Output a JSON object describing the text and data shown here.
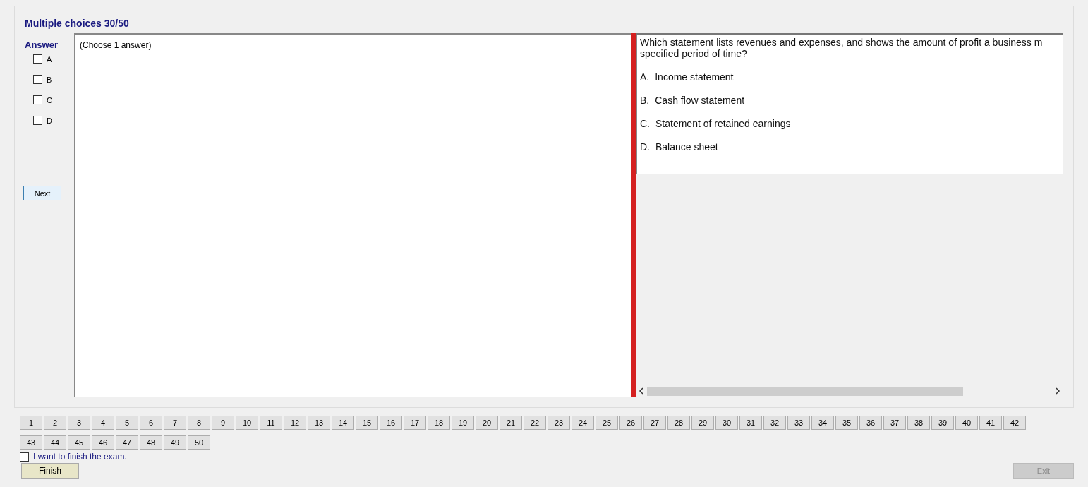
{
  "title": "Multiple choices 30/50",
  "answer_panel": {
    "heading": "Answer",
    "options": [
      {
        "label": "A",
        "checked": false
      },
      {
        "label": "B",
        "checked": false
      },
      {
        "label": "C",
        "checked": false
      },
      {
        "label": "D",
        "checked": false
      }
    ],
    "next_button": "Next"
  },
  "instruction": "(Choose 1 answer)",
  "question": {
    "lines": [
      "Which statement lists revenues and expenses, and shows the amount of profit a business m",
      "specified period of time?"
    ],
    "choices": [
      {
        "letter": "A.",
        "text": "Income statement"
      },
      {
        "letter": "B.",
        "text": "Cash flow statement"
      },
      {
        "letter": "C.",
        "text": "Statement of retained earnings"
      },
      {
        "letter": "D.",
        "text": "Balance sheet"
      }
    ]
  },
  "question_numbers": [
    "1",
    "2",
    "3",
    "4",
    "5",
    "6",
    "7",
    "8",
    "9",
    "10",
    "11",
    "12",
    "13",
    "14",
    "15",
    "16",
    "17",
    "18",
    "19",
    "20",
    "21",
    "22",
    "23",
    "24",
    "25",
    "26",
    "27",
    "28",
    "29",
    "30",
    "31",
    "32",
    "33",
    "34",
    "35",
    "36",
    "37",
    "38",
    "39",
    "40",
    "41",
    "42",
    "43",
    "44",
    "45",
    "46",
    "47",
    "48",
    "49",
    "50"
  ],
  "finish": {
    "label": "I want to finish the exam.",
    "checked": false,
    "button": "Finish"
  },
  "exit_button": {
    "label": "Exit",
    "disabled": true
  }
}
